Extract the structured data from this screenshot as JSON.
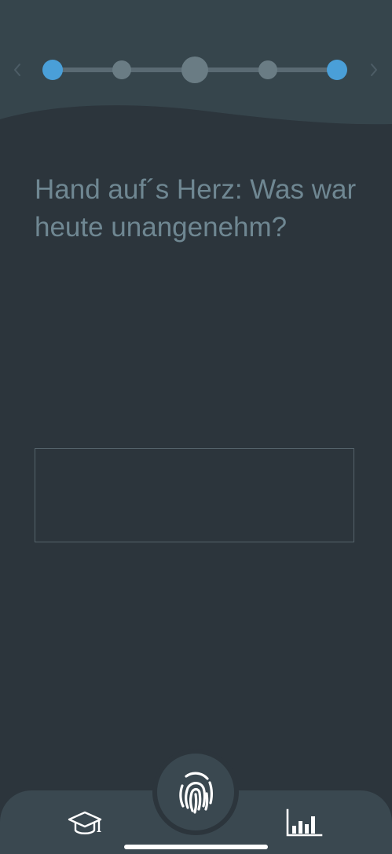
{
  "question": {
    "text": "Hand auf´s Herz: Was war heute unangenehm?"
  },
  "answer": {
    "value": "",
    "placeholder": ""
  },
  "stepper": {
    "total_steps": 5,
    "active_steps": [
      1,
      5
    ],
    "current_step": 3
  },
  "nav": {
    "prev_icon": "chevron-left-icon",
    "next_icon": "chevron-right-icon"
  },
  "tabbar": {
    "left_icon": "graduation-cap-icon",
    "center_icon": "fingerprint-icon",
    "right_icon": "bar-chart-icon"
  },
  "colors": {
    "background": "#2c353c",
    "header": "#36454c",
    "accent": "#4a9fd8",
    "inactive_dot": "#6a7c84",
    "question_text": "#6f8792",
    "tabbar": "#3a4850",
    "icon": "#ffffff"
  }
}
